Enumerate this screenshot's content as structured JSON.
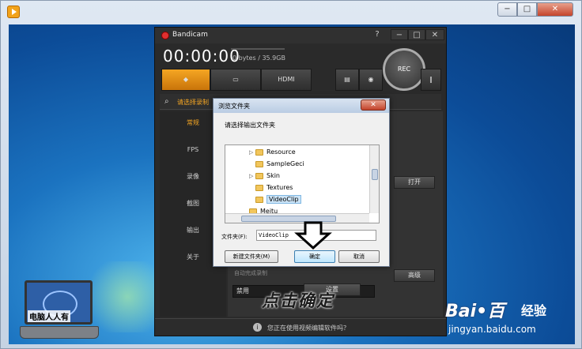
{
  "outer_window": {
    "min_label": "−",
    "max_label": "□",
    "close_label": "✕"
  },
  "logo": {
    "text": "电脑人人有"
  },
  "bandicam": {
    "app_name": "Bandicam",
    "help_label": "?",
    "min_label": "−",
    "max_label": "□",
    "close_label": "✕",
    "timer": "00:00:00",
    "size": "0 bytes / 35.9GB",
    "rec_label": "REC",
    "tabs": [
      {
        "name": "game",
        "label": ""
      },
      {
        "name": "screen",
        "label": ""
      },
      {
        "name": "hdmi",
        "label": "HDMI"
      },
      {
        "name": "folder",
        "label": ""
      },
      {
        "name": "camera",
        "label": ""
      },
      {
        "name": "pause",
        "label": ""
      }
    ],
    "search_text": "请选择录制",
    "sidebar": [
      {
        "label": "常规"
      },
      {
        "label": "FPS"
      },
      {
        "label": "录像"
      },
      {
        "label": "截图"
      },
      {
        "label": "输出"
      },
      {
        "label": "关于"
      }
    ],
    "open_button": "打开",
    "advanced_button": "高级",
    "hotkey_label": "自动完成录制",
    "hotkey_value": "禁用",
    "settings_button": "设置",
    "footer_text": "您正在使用视频编辑软件吗？"
  },
  "dialog": {
    "title": "浏览文件夹",
    "close_label": "✕",
    "prompt": "请选择输出文件夹",
    "tree": [
      {
        "label": "Resource",
        "expandable": true
      },
      {
        "label": "SampleGeci",
        "expandable": false
      },
      {
        "label": "Skin",
        "expandable": true
      },
      {
        "label": "Textures",
        "expandable": false
      },
      {
        "label": "VideoClip",
        "expandable": false,
        "selected": true
      },
      {
        "label": "Meitu",
        "expandable": false
      }
    ],
    "folder_label": "文件夹(F):",
    "folder_value": "VideoClip",
    "new_folder_button": "新建文件夹(M)",
    "ok_button": "确定",
    "cancel_button": "取消"
  },
  "annotation": {
    "text": "点击确定"
  },
  "watermark": {
    "logo_text": "Bai•百",
    "brand": "经验",
    "url": "jingyan.baidu.com"
  },
  "colors": {
    "accent": "#f5a623",
    "rec": "#e03030",
    "desktop": "#1b73c0"
  },
  "icons": {
    "app": "play-icon",
    "search": "search-icon",
    "info": "info-icon",
    "folder": "folder-icon"
  }
}
